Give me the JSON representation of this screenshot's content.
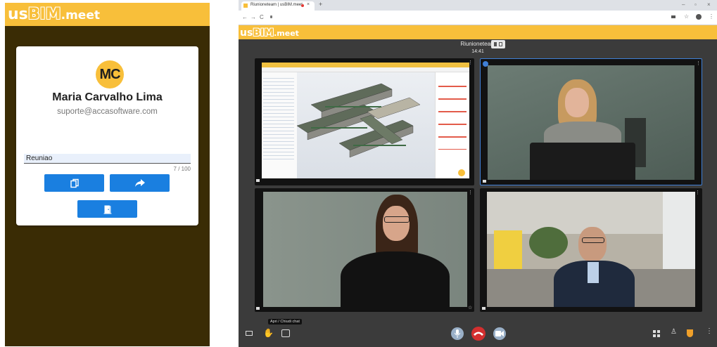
{
  "logo": {
    "us": "us",
    "bim": "BIM",
    "meet": ".meet"
  },
  "user": {
    "initials": "MC",
    "name": "Maria Carvalho Lima",
    "email": "suporte@accasoftware.com"
  },
  "room": {
    "value": "Reuniao",
    "counter": "7 / 100"
  },
  "buttons": {
    "copy_icon": "copy-icon",
    "share_icon": "share-icon",
    "enter_icon": "door-icon"
  },
  "browser": {
    "tab_title": "Riunioneteam | usBIM.meet",
    "nav_icons": [
      "back-icon",
      "forward-icon",
      "reload-icon"
    ]
  },
  "meeting": {
    "title": "Riunioneteam",
    "time": "14:41",
    "tooltip": "Apri / Chiudi chat"
  },
  "colors": {
    "brand": "#f8bf3a",
    "left_bg": "#3a2c05",
    "button": "#1a7fe0",
    "hangup": "#d32f2f",
    "active_border": "#3f7fd6"
  }
}
